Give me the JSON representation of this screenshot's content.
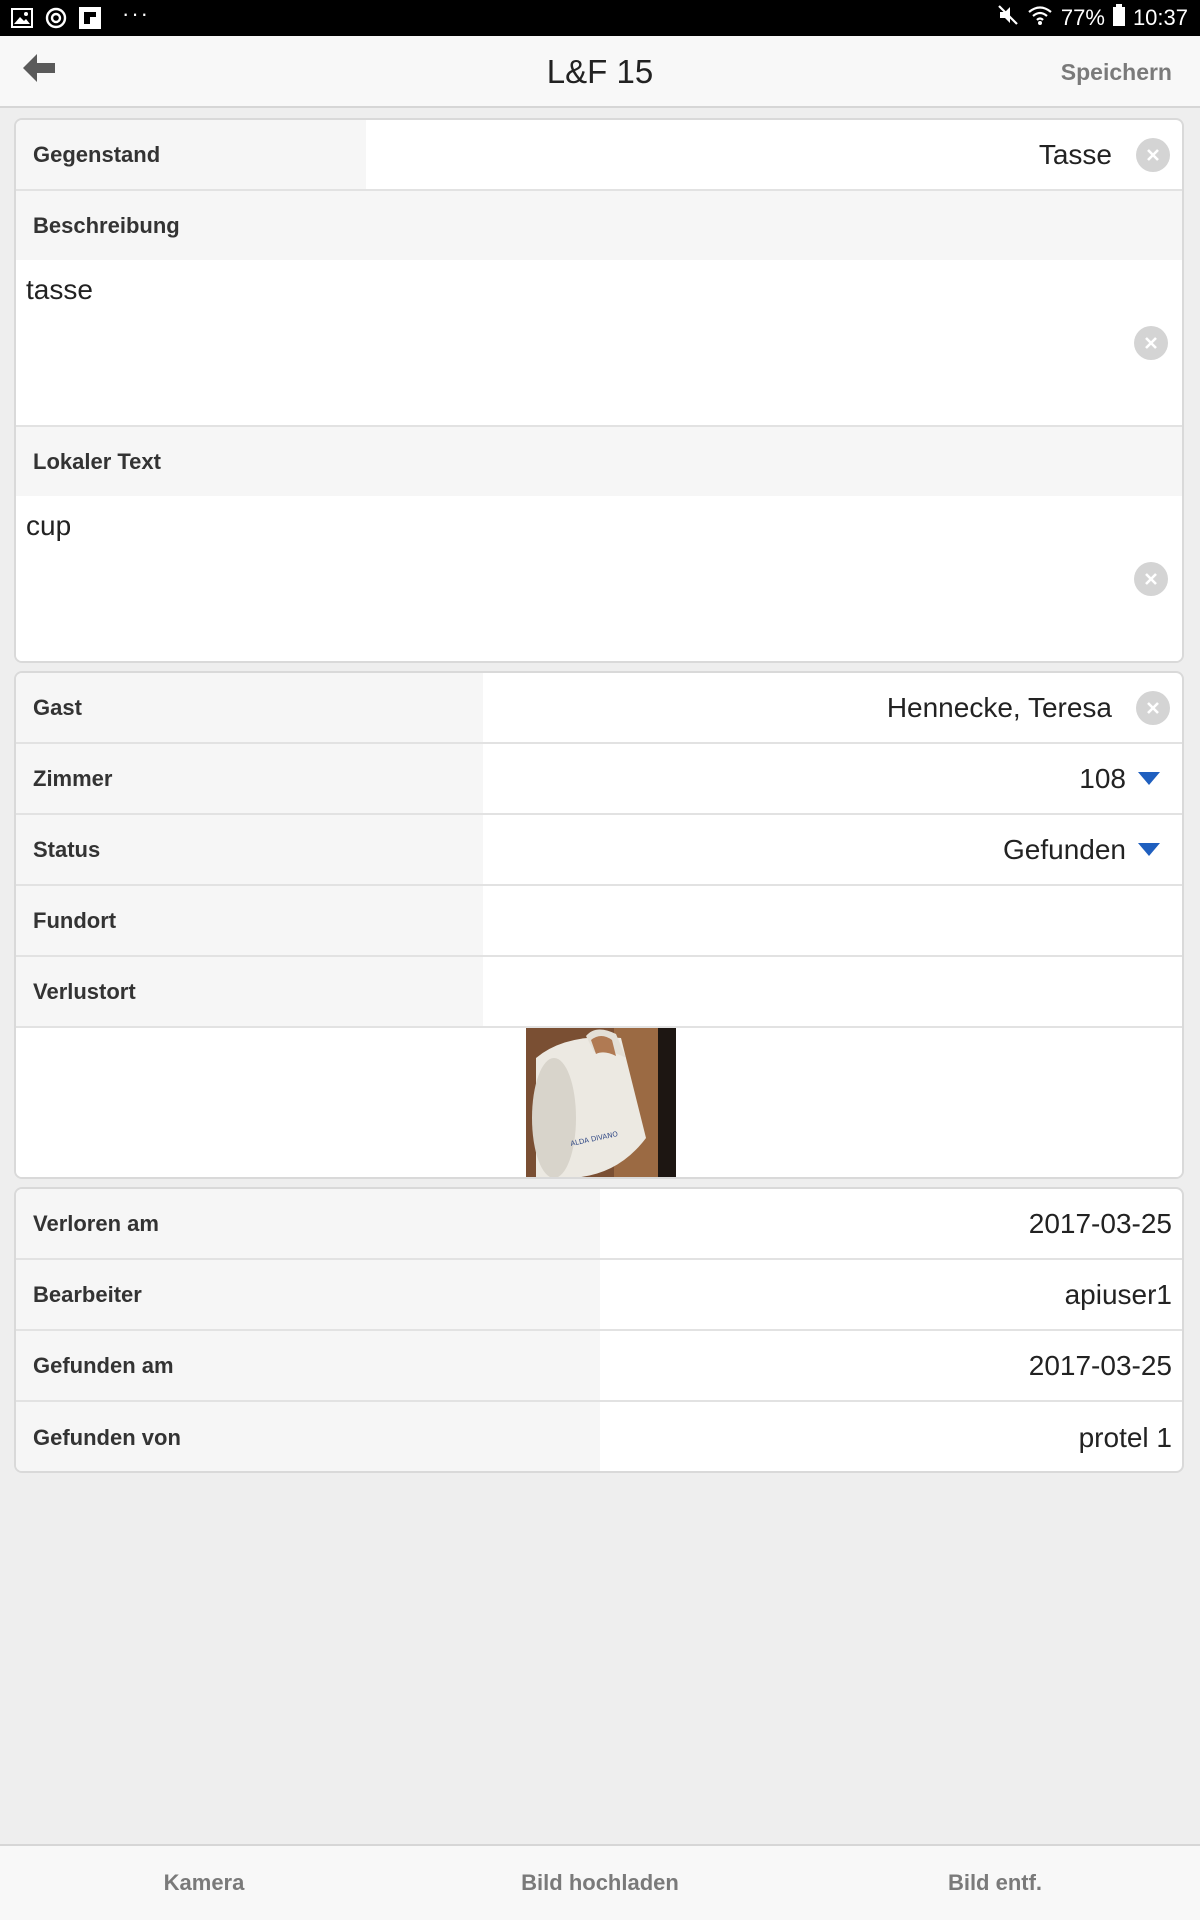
{
  "status_bar": {
    "left_icons": [
      "gallery-icon",
      "sync-icon",
      "flipboard-icon"
    ],
    "more": "···",
    "battery_percent": "77%",
    "time": "10:37"
  },
  "header": {
    "title": "L&F 15",
    "save_label": "Speichern"
  },
  "item_card": {
    "gegenstand": {
      "label": "Gegenstand",
      "value": "Tasse"
    },
    "beschreibung": {
      "label": "Beschreibung",
      "value": "tasse"
    },
    "lokaler_text": {
      "label": "Lokaler Text",
      "value": "cup"
    }
  },
  "guest_card": {
    "gast": {
      "label": "Gast",
      "value": "Hennecke, Teresa"
    },
    "zimmer": {
      "label": "Zimmer",
      "value": "108"
    },
    "status": {
      "label": "Status",
      "value": "Gefunden"
    },
    "fundort": {
      "label": "Fundort",
      "value": ""
    },
    "verlustort": {
      "label": "Verlustort",
      "value": ""
    }
  },
  "info_card": {
    "verloren_am": {
      "label": "Verloren am",
      "value": "2017-03-25"
    },
    "bearbeiter": {
      "label": "Bearbeiter",
      "value": "apiuser1"
    },
    "gefunden_am": {
      "label": "Gefunden am",
      "value": "2017-03-25"
    },
    "gefunden_von": {
      "label": "Gefunden von",
      "value": "protel 1"
    }
  },
  "bottom_bar": {
    "camera": "Kamera",
    "upload": "Bild hochladen",
    "remove": "Bild entf."
  },
  "colors": {
    "accent_caret": "#1f5fbf",
    "status_bar": "#000000",
    "background": "#eeeeee"
  }
}
